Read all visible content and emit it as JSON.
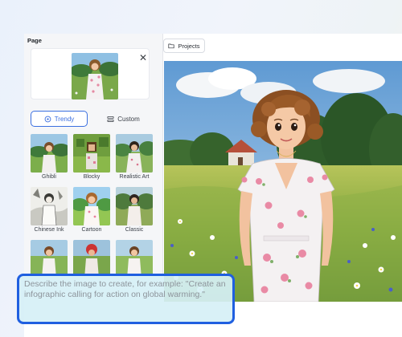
{
  "panel": {
    "title": "Page"
  },
  "tabs": [
    {
      "label": "Trendy",
      "icon": "sparkle-icon",
      "active": true
    },
    {
      "label": "Custom",
      "icon": "sliders-icon",
      "active": false
    }
  ],
  "styles": [
    {
      "label": "Ghibli"
    },
    {
      "label": "Blocky"
    },
    {
      "label": "Realistic Art"
    },
    {
      "label": "Chinese Ink"
    },
    {
      "label": "Cartoon"
    },
    {
      "label": "Classic"
    },
    {
      "label": ""
    },
    {
      "label": ""
    },
    {
      "label": ""
    }
  ],
  "toolbar": {
    "projects_label": "Projects"
  },
  "prompt": {
    "placeholder": "Describe the image to create, for example: \"Create an infographic calling for action on global warming.\""
  },
  "colors": {
    "accent": "#3b6fe0",
    "prompt_border": "#1f5fe0"
  }
}
